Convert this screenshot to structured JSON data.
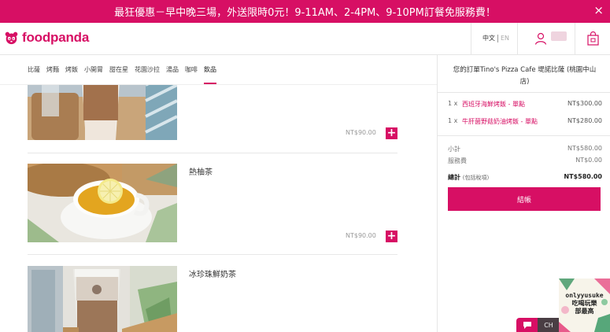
{
  "promo": {
    "text": "最狂優惠－早中晚三場，外送限時0元！9-11AM、2-4PM、9-10PM訂餐免服務費！",
    "close": "×"
  },
  "header": {
    "brand": "foodpanda",
    "lang_active": "中文",
    "lang_other": "EN",
    "icons": [
      "panda-logo-icon",
      "user-icon",
      "shopping-bag-icon"
    ]
  },
  "categories": [
    "比薩",
    "烤麵",
    "烤飯",
    "小開胃",
    "甜在星",
    "花園沙拉",
    "湯品",
    "咖啡",
    "飲品"
  ],
  "active_category": "飲品",
  "menu_items": [
    {
      "name": "",
      "price": "NT$90.00",
      "add": "+"
    },
    {
      "name": "熱柚茶",
      "price": "NT$90.00",
      "add": "+"
    },
    {
      "name": "冰珍珠鮮奶茶",
      "price": "",
      "add": ""
    }
  ],
  "order": {
    "title": "您的訂單Tino's Pizza Cafe 堤諾比薩 (桃園中山店)",
    "items": [
      {
        "qty": "1 x",
        "name": "西班牙海鮮烤飯 - 單點",
        "price": "NT$300.00"
      },
      {
        "qty": "1 x",
        "name": "牛肝菌野菇奶油烤飯 - 單點",
        "price": "NT$280.00"
      }
    ],
    "subtotal_label": "小計",
    "subtotal": "NT$580.00",
    "service_label": "服務費",
    "service": "NT$0.00",
    "total_label": "總計",
    "total_note": "(包括稅項)",
    "total": "NT$580.00",
    "checkout": "結帳"
  },
  "ad": {
    "line1": "onlyyusuke",
    "line2": "吃喝玩樂",
    "line3": "部最高"
  },
  "chat_dark_label": "CH",
  "colors": {
    "brand": "#d70f64"
  }
}
